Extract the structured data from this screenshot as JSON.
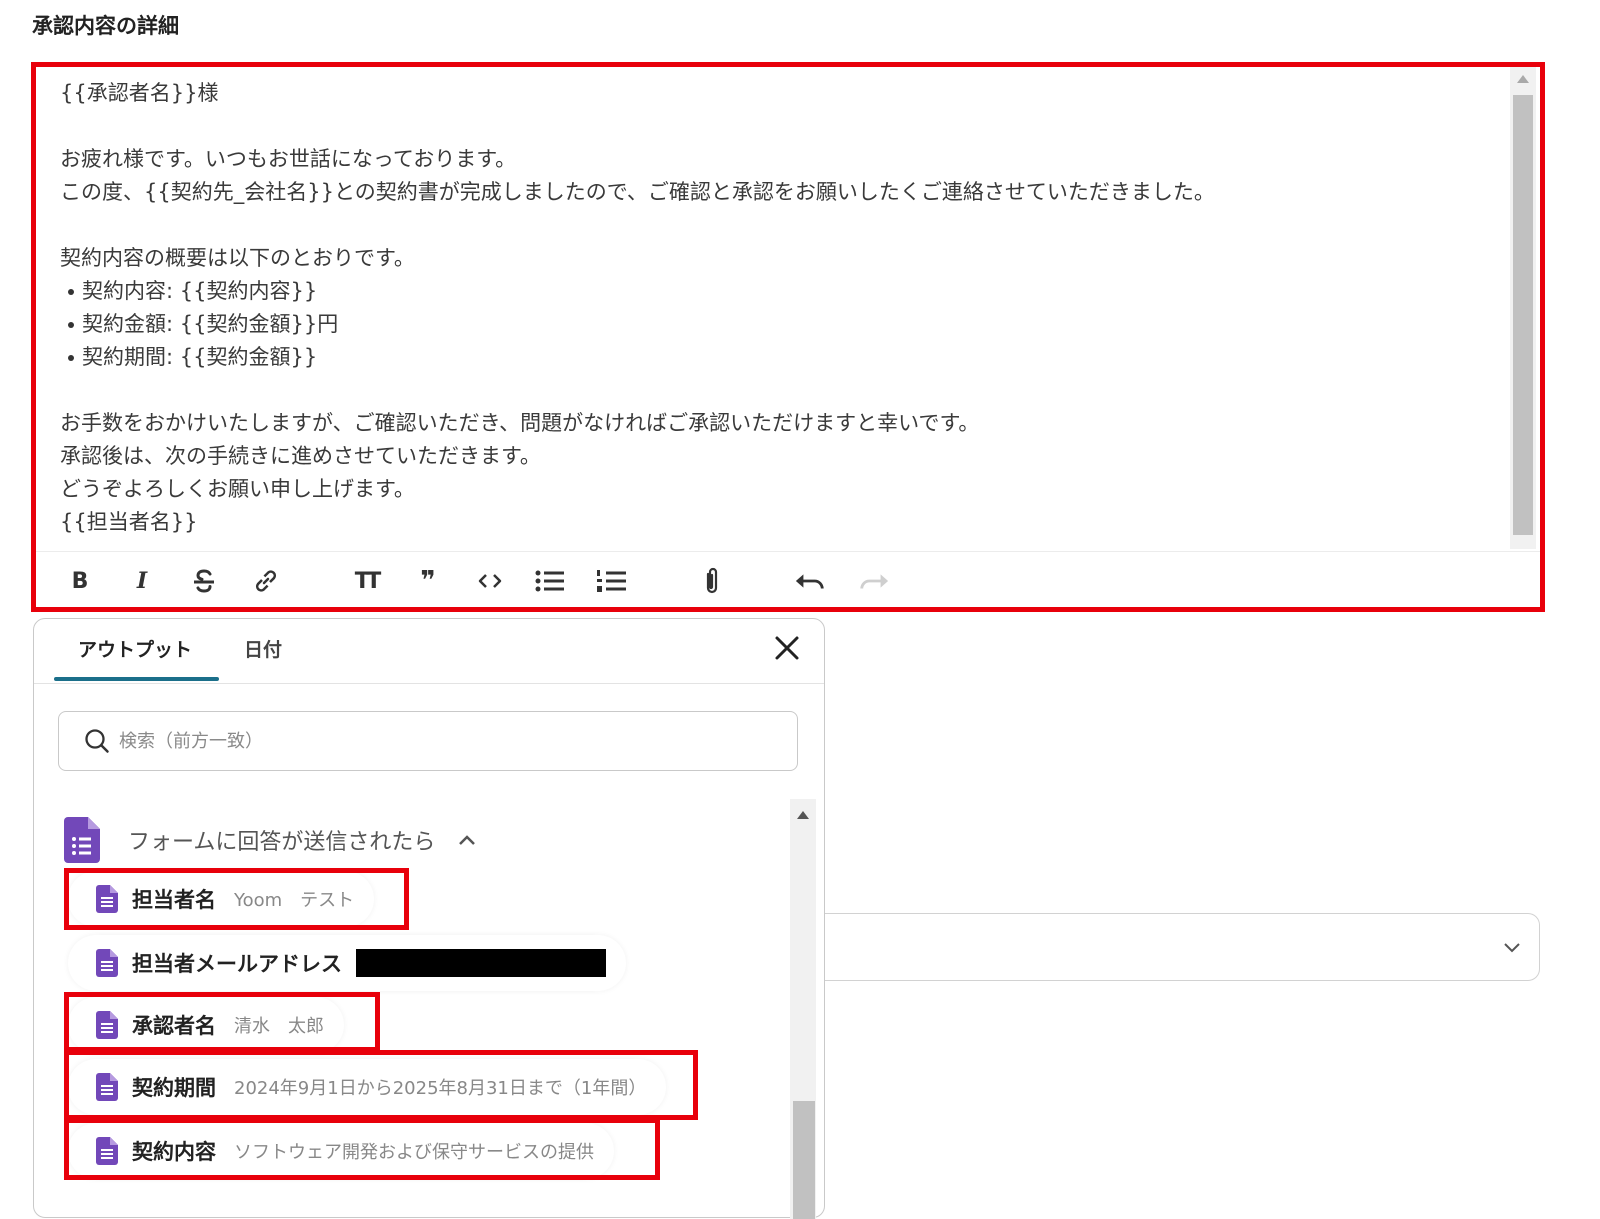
{
  "section": {
    "title": "承認内容の詳細"
  },
  "editor": {
    "lines": {
      "l1": "{{承認者名}}様",
      "l2": "お疲れ様です。いつもお世話になっております。",
      "l3": "この度、{{契約先_会社名}}との契約書が完成しましたので、ご確認と承認をお願いしたくご連絡させていただきました。",
      "l4": "契約内容の概要は以下のとおりです。",
      "b1": "契約内容: {{契約内容}}",
      "b2": "契約金額: {{契約金額}}円",
      "b3": "契約期間: {{契約金額}}",
      "l5": "お手数をおかけいたしますが、ご確認いただき、問題がなければご承認いただけますと幸いです。",
      "l6": "承認後は、次の手続きに進めさせていただきます。",
      "l7": "どうぞよろしくお願い申し上げます。",
      "l8": "{{担当者名}}"
    },
    "toolbar": {
      "bold": "B",
      "italic": "I",
      "heading": "TT",
      "quote": "❞"
    }
  },
  "panel": {
    "tabs": {
      "output": "アウトプット",
      "date": "日付"
    },
    "search": {
      "placeholder": "検索（前方一致）"
    },
    "group": {
      "label": "フォームに回答が送信されたら"
    },
    "items": [
      {
        "name": "担当者名",
        "value": "Yoom　テスト"
      },
      {
        "name": "担当者メールアドレス",
        "value": ""
      },
      {
        "name": "承認者名",
        "value": "清水　太郎"
      },
      {
        "name": "契約期間",
        "value": "2024年9月1日から2025年8月31日まで（1年間）"
      },
      {
        "name": "契約内容",
        "value": "ソフトウェア開発および保守サービスの提供"
      }
    ]
  },
  "colors": {
    "highlight": "#e8000b",
    "tab_accent": "#1b6f8a",
    "form_icon": "#7248b9"
  }
}
